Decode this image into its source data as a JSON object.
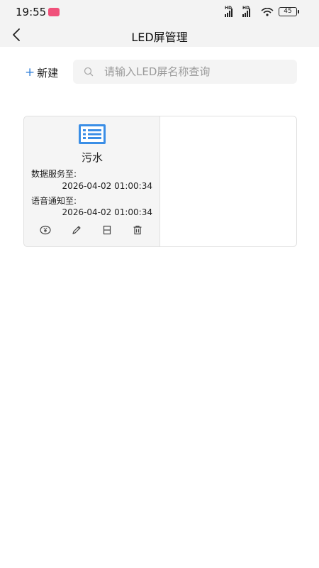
{
  "status_bar": {
    "time": "19:55",
    "network_1": "HD",
    "network_2": "HD",
    "battery": "45"
  },
  "header": {
    "title": "LED屏管理",
    "back_icon": "chevron-left-icon"
  },
  "toolbar": {
    "new_plus": "+",
    "new_label": "新建",
    "search_placeholder": "请输入LED屏名称查询",
    "search_value": "",
    "search_icon": "search-icon"
  },
  "cards": [
    {
      "name": "污水",
      "icon": "list-screen-icon",
      "data_service_label": "数据服务至:",
      "data_service_value": "2026-04-02 01:00:34",
      "voice_notify_label": "语音通知至:",
      "voice_notify_value": "2026-04-02 01:00:34",
      "actions": [
        "yen-icon",
        "edit-icon",
        "save-icon",
        "delete-icon"
      ]
    }
  ],
  "colors": {
    "accent": "#2f7ed8",
    "header_bg": "#f3f3f3",
    "card_bg": "#f5f5f5"
  }
}
